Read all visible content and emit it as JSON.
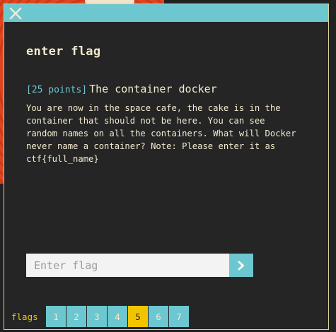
{
  "dialog": {
    "close_icon": "close-icon",
    "heading": "enter flag"
  },
  "challenge": {
    "points": "[25 points]",
    "title": "The container docker",
    "description": "You are now in the space cafe, the cake is in the\ncontainer that should not be here. You can see\nrandom names on all the containers. What will Docker\nnever name a container? Note: Please enter it as\nctf{full_name}"
  },
  "form": {
    "placeholder": "Enter flag",
    "value": "",
    "submit_icon": "chevron-right-icon"
  },
  "flags": {
    "label": "flags",
    "tabs": [
      "1",
      "2",
      "3",
      "4",
      "5",
      "6",
      "7"
    ],
    "active_index": 4
  },
  "colors": {
    "accent": "#6cc7d0",
    "active_tab": "#f2c400",
    "text": "#f3ead0",
    "background": "#252525"
  }
}
